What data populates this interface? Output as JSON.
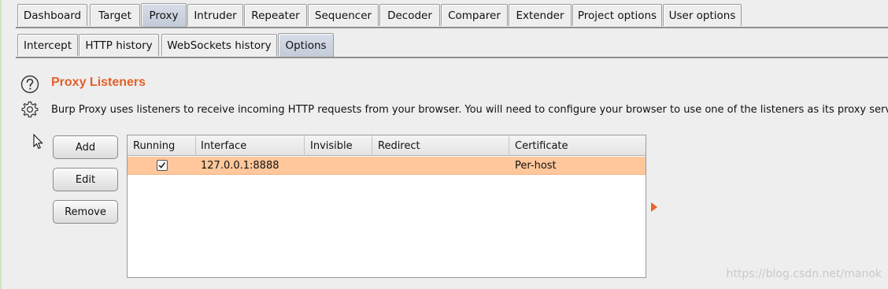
{
  "main_tabs": [
    {
      "label": "Dashboard",
      "selected": false
    },
    {
      "label": "Target",
      "selected": false
    },
    {
      "label": "Proxy",
      "selected": true
    },
    {
      "label": "Intruder",
      "selected": false
    },
    {
      "label": "Repeater",
      "selected": false
    },
    {
      "label": "Sequencer",
      "selected": false
    },
    {
      "label": "Decoder",
      "selected": false
    },
    {
      "label": "Comparer",
      "selected": false
    },
    {
      "label": "Extender",
      "selected": false
    },
    {
      "label": "Project options",
      "selected": false
    },
    {
      "label": "User options",
      "selected": false
    }
  ],
  "sub_tabs": [
    {
      "label": "Intercept",
      "selected": false
    },
    {
      "label": "HTTP history",
      "selected": false
    },
    {
      "label": "WebSockets history",
      "selected": false
    },
    {
      "label": "Options",
      "selected": true
    }
  ],
  "section": {
    "title": "Proxy Listeners",
    "description": "Burp Proxy uses listeners to receive incoming HTTP requests from your browser. You will need to configure your browser to use one of the listeners as its proxy server.",
    "help_icon": "help-icon",
    "settings_icon": "gear-icon"
  },
  "buttons": {
    "add": "Add",
    "edit": "Edit",
    "remove": "Remove"
  },
  "table": {
    "columns": [
      "Running",
      "Interface",
      "Invisible",
      "Redirect",
      "Certificate"
    ],
    "rows": [
      {
        "running": true,
        "interface": "127.0.0.1:8888",
        "invisible": "",
        "redirect": "",
        "certificate": "Per-host"
      }
    ]
  },
  "watermark": "https://blog.csdn.net/manok",
  "colors": {
    "accent": "#e35f2a",
    "selected_row": "#ffc79b",
    "selected_tab": "#c9d0dc"
  }
}
